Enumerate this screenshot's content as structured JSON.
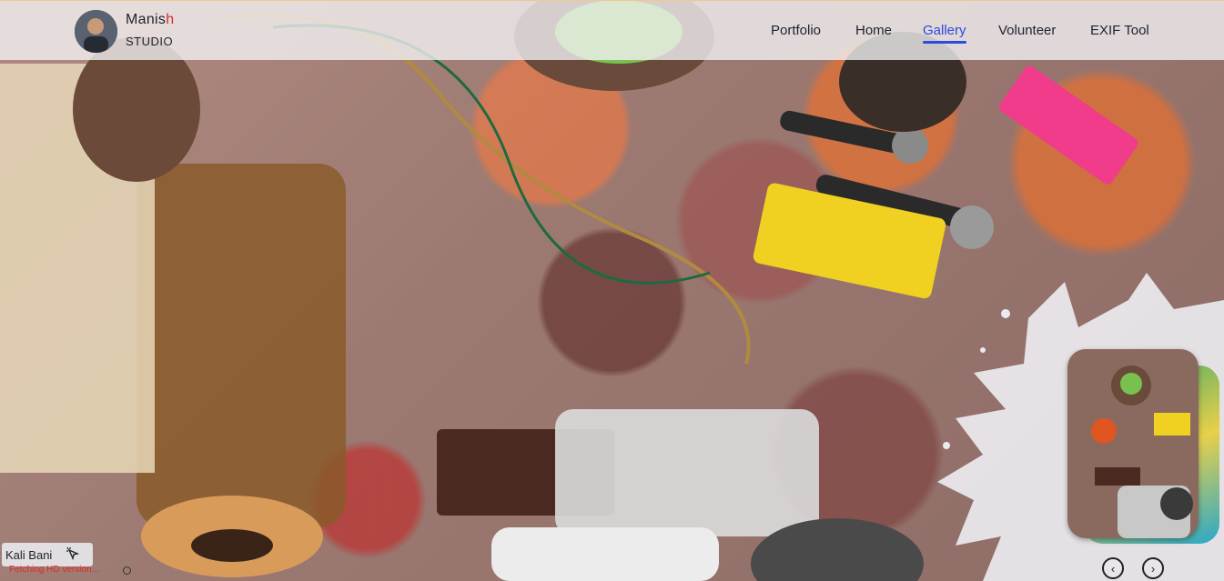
{
  "brand": {
    "name_main": "Manis",
    "name_accent": "h",
    "subtitle": "STUDIO"
  },
  "nav": [
    {
      "label": "Portfolio",
      "active": false
    },
    {
      "label": "Home",
      "active": false
    },
    {
      "label": "Gallery",
      "active": true
    },
    {
      "label": "Volunteer",
      "active": false
    },
    {
      "label": "EXIF Tool",
      "active": false
    }
  ],
  "caption": {
    "title": "Kali Bani",
    "icon": "sparkle-cursor-icon"
  },
  "status": {
    "text": "Fetching HD version...",
    "icon": "loading-ring-icon"
  },
  "carousel": {
    "prev_icon": "chevron-left-icon",
    "next_icon": "chevron-right-icon",
    "prev_glyph": "‹",
    "next_glyph": "›"
  },
  "colors": {
    "accent": "#2c49e0",
    "brand_red": "#d82a2a",
    "status_red": "#e02b2b"
  }
}
